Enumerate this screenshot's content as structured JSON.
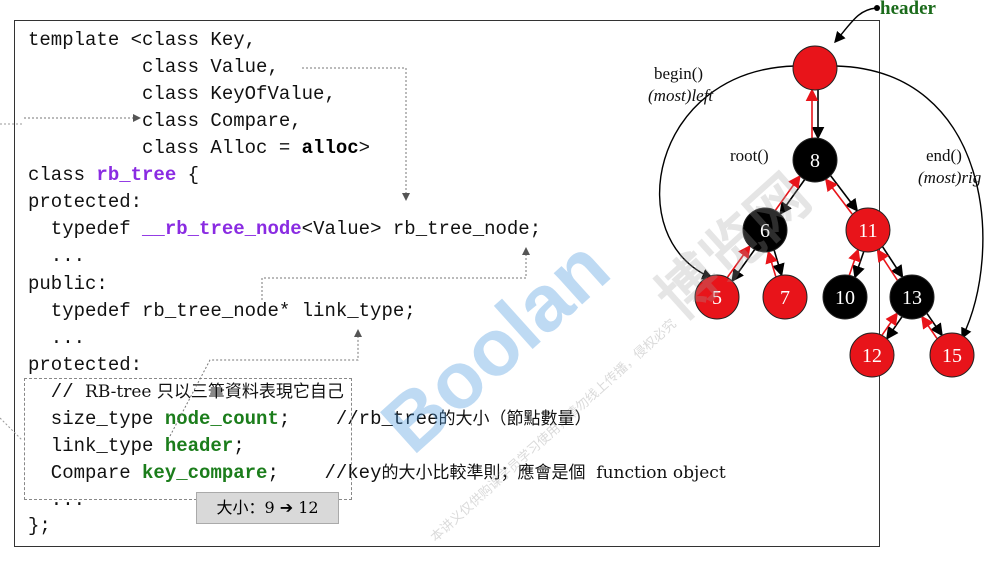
{
  "code": {
    "lines": [
      {
        "segments": [
          {
            "t": "template <class Key,"
          }
        ]
      },
      {
        "segments": [
          {
            "t": "          class Value,"
          }
        ]
      },
      {
        "segments": [
          {
            "t": "          class KeyOfValue,"
          }
        ]
      },
      {
        "segments": [
          {
            "t": "          class Compare,"
          }
        ]
      },
      {
        "segments": [
          {
            "t": "          class Alloc = "
          },
          {
            "t": "alloc",
            "s": "bold"
          },
          {
            "t": ">"
          }
        ]
      },
      {
        "segments": [
          {
            "t": "class "
          },
          {
            "t": "rb_tree",
            "s": "purple"
          },
          {
            "t": " {"
          }
        ]
      },
      {
        "segments": [
          {
            "t": "protected:"
          }
        ]
      },
      {
        "segments": [
          {
            "t": "  typedef "
          },
          {
            "t": "__rb_tree_node",
            "s": "purple"
          },
          {
            "t": "<Value> rb_tree_node;"
          }
        ]
      },
      {
        "segments": [
          {
            "t": "  ..."
          }
        ]
      },
      {
        "segments": [
          {
            "t": "public:"
          }
        ]
      },
      {
        "segments": [
          {
            "t": "  typedef rb_tree_node* link_type;"
          }
        ]
      },
      {
        "segments": [
          {
            "t": "  ..."
          }
        ]
      },
      {
        "segments": [
          {
            "t": "protected:"
          }
        ]
      },
      {
        "segments": [
          {
            "t": "  // "
          },
          {
            "t": "RB-tree 只以三筆資料表現它自己",
            "s": "cn"
          }
        ]
      },
      {
        "segments": [
          {
            "t": "  size_type "
          },
          {
            "t": "node_count",
            "s": "green"
          },
          {
            "t": ";    //rb_tree"
          },
          {
            "t": "的大小（節點數量）",
            "s": "cn"
          }
        ]
      },
      {
        "segments": [
          {
            "t": "  link_type "
          },
          {
            "t": "header",
            "s": "green"
          },
          {
            "t": ";"
          }
        ]
      },
      {
        "segments": [
          {
            "t": "  Compare "
          },
          {
            "t": "key_compare",
            "s": "green"
          },
          {
            "t": ";    //key"
          },
          {
            "t": "的大小比較準則；應會是個  function object",
            "s": "cn"
          }
        ]
      },
      {
        "segments": [
          {
            "t": "  ..."
          }
        ]
      },
      {
        "segments": [
          {
            "t": "};"
          }
        ]
      }
    ]
  },
  "size_note": "大小：9 ➔ 12",
  "tree": {
    "header_label": "header",
    "begin_label": "begin()",
    "begin_sub": "(most)left",
    "root_label": "root()",
    "end_label": "end()",
    "end_sub": "(most)rig",
    "nodes": [
      {
        "id": "header",
        "label": "",
        "color": "#e8141a"
      },
      {
        "id": "n8",
        "label": "8",
        "color": "#000000"
      },
      {
        "id": "n6",
        "label": "6",
        "color": "#000000"
      },
      {
        "id": "n11",
        "label": "11",
        "color": "#e8141a"
      },
      {
        "id": "n5",
        "label": "5",
        "color": "#e8141a"
      },
      {
        "id": "n7",
        "label": "7",
        "color": "#e8141a"
      },
      {
        "id": "n10",
        "label": "10",
        "color": "#000000"
      },
      {
        "id": "n13",
        "label": "13",
        "color": "#000000"
      },
      {
        "id": "n12",
        "label": "12",
        "color": "#e8141a"
      },
      {
        "id": "n15",
        "label": "15",
        "color": "#e8141a"
      }
    ]
  },
  "watermark": {
    "brand": "Boolan",
    "cn": "博览网",
    "small": "本讲义仅供购课学员学习使用，请勿线上传播，侵权必究"
  },
  "colors": {
    "red": "#e8141a",
    "black": "#000000",
    "purple": "#8a2be2",
    "green": "#1b7d1b"
  }
}
